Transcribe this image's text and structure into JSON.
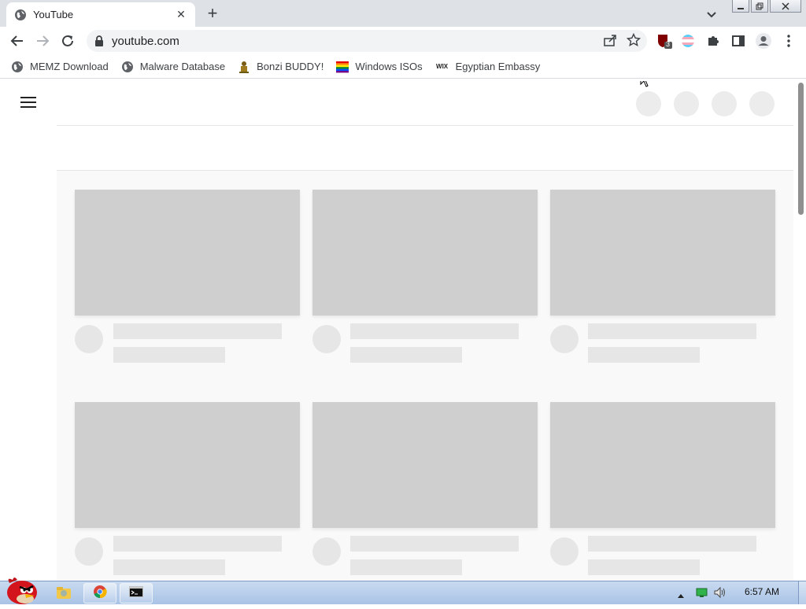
{
  "browser": {
    "tab": {
      "title": "YouTube"
    },
    "new_tab_symbol": "+",
    "tab_close_symbol": "✕",
    "address_bar": {
      "url": "youtube.com"
    },
    "extension_badge": "3"
  },
  "bookmarks": [
    {
      "label": "MEMZ Download",
      "icon": "globe-icon"
    },
    {
      "label": "Malware Database",
      "icon": "globe-icon"
    },
    {
      "label": "Bonzi BUDDY!",
      "icon": "bonzi-icon"
    },
    {
      "label": "Windows ISOs",
      "icon": "rainbow-flag-icon"
    },
    {
      "label": "Egyptian Embassy",
      "icon": "wix-icon"
    }
  ],
  "bookmark_wix_text": "WIX",
  "taskbar": {
    "clock": "6:57 AM"
  },
  "colors": {
    "skeleton_thumb": "#cfcfcf",
    "skeleton_line": "#e6e6e6",
    "tabstrip": "#dee1e6",
    "accent_blue": "#1a73e8"
  }
}
